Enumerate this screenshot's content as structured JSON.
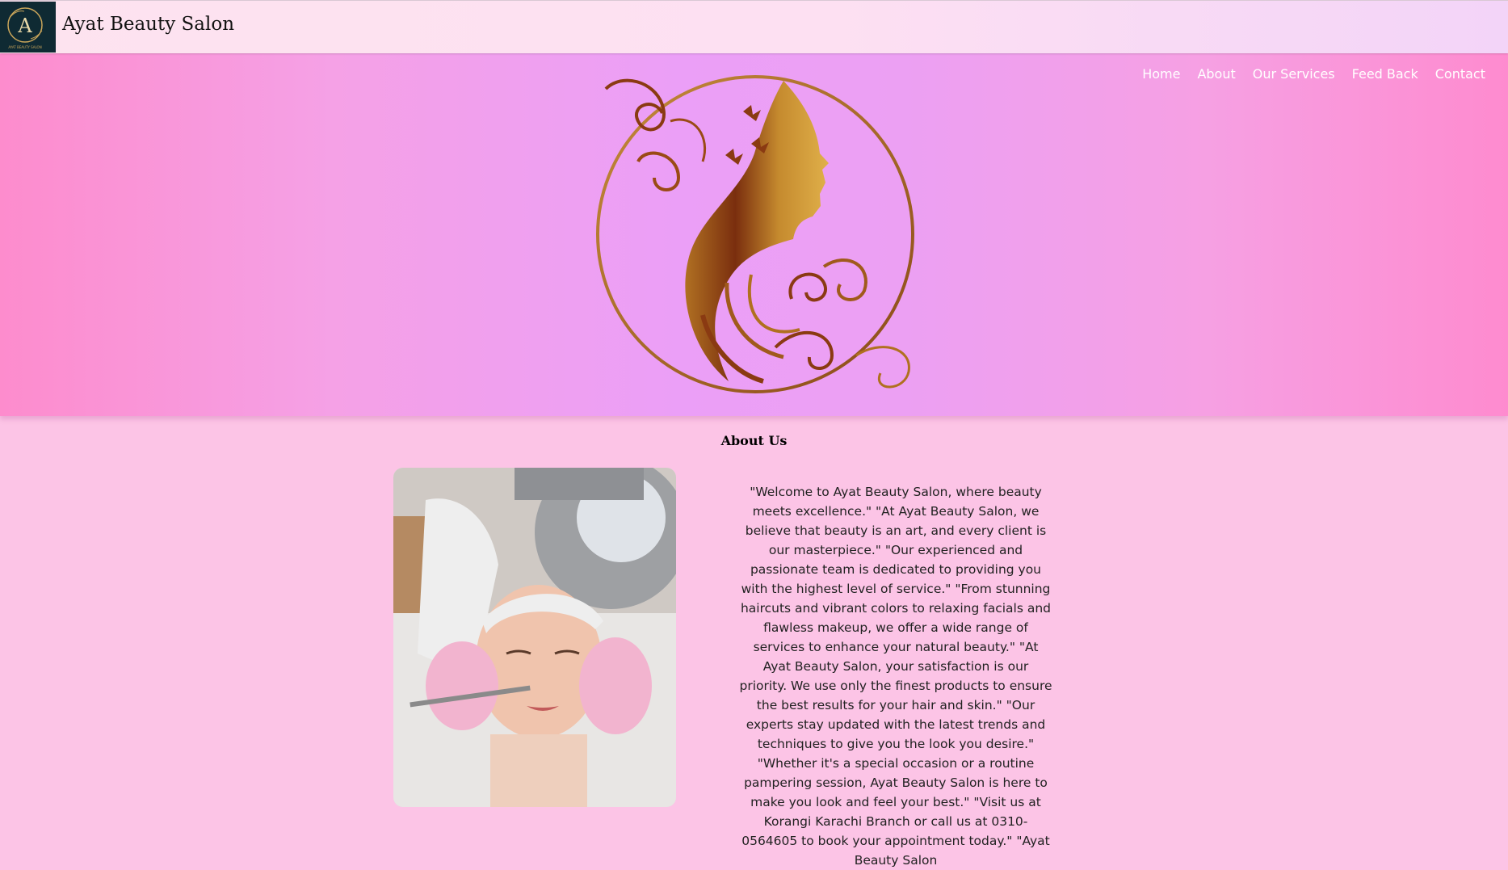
{
  "header": {
    "brand": "Ayat Beauty Salon",
    "logo_icon": "salon-logo-icon",
    "logo_letter": "A",
    "logo_caption": "AYAT BEAUTY SALON"
  },
  "nav": {
    "items": [
      {
        "label": "Home"
      },
      {
        "label": "About"
      },
      {
        "label": "Our Services"
      },
      {
        "label": "Feed Back"
      },
      {
        "label": "Contact"
      }
    ]
  },
  "hero": {
    "emblem_icon": "woman-silhouette-emblem-icon"
  },
  "about": {
    "heading": "About Us",
    "photo_icon": "facial-treatment-photo",
    "text": "\"Welcome to Ayat Beauty Salon, where beauty meets excellence.\" \"At Ayat Beauty Salon, we believe that beauty is an art, and every client is our masterpiece.\" \"Our experienced and passionate team is dedicated to providing you with the highest level of service.\" \"From stunning haircuts and vibrant colors to relaxing facials and flawless makeup, we offer a wide range of services to enhance your natural beauty.\" \"At Ayat Beauty Salon, your satisfaction is our priority. We use only the finest products to ensure the best results for your hair and skin.\" \"Our experts stay updated with the latest trends and techniques to give you the look you desire.\" \"Whether it's a special occasion or a routine pampering session, Ayat Beauty Salon is here to make you look and feel your best.\" \"Visit us at Korangi Karachi Branch or call us at 0310-0564605 to book your appointment today.\" \"Ayat Beauty Salon"
  },
  "colors": {
    "hero_left": "#fd8ccd",
    "hero_center": "#eb9ff7",
    "page_background": "#fcc4e6",
    "gold": "#b5762a"
  }
}
